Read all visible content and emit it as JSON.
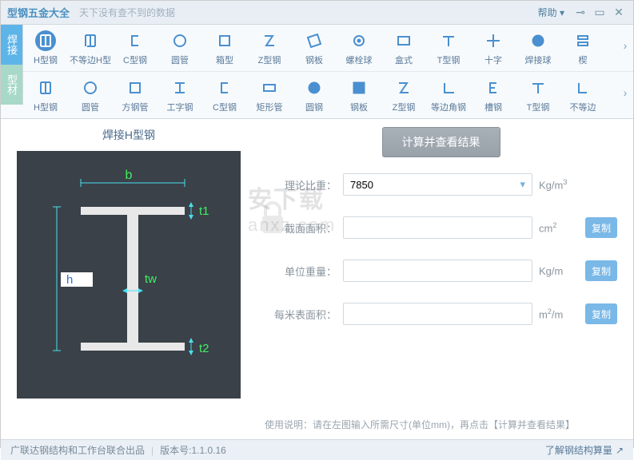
{
  "titlebar": {
    "title": "型钢五金大全",
    "subtitle": "天下没有查不到的数据",
    "help": "帮助"
  },
  "sideTabs": {
    "hj": "焊接",
    "xc": "型材"
  },
  "toolbar1": [
    {
      "label": "H型钢",
      "icon": "hbeam",
      "active": true
    },
    {
      "label": "不等边H型",
      "icon": "hbeam2"
    },
    {
      "label": "C型钢",
      "icon": "cshape"
    },
    {
      "label": "圆管",
      "icon": "circle"
    },
    {
      "label": "箱型",
      "icon": "box"
    },
    {
      "label": "Z型钢",
      "icon": "zshape"
    },
    {
      "label": "钢板",
      "icon": "plate"
    },
    {
      "label": "螺栓球",
      "icon": "bolt"
    },
    {
      "label": "盒式",
      "icon": "box2"
    },
    {
      "label": "T型钢",
      "icon": "tshape"
    },
    {
      "label": "十字",
      "icon": "cross"
    },
    {
      "label": "焊接球",
      "icon": "sphere"
    },
    {
      "label": "楔",
      "icon": "wedge"
    }
  ],
  "toolbar2": [
    {
      "label": "H型钢",
      "icon": "hbeam"
    },
    {
      "label": "圆管",
      "icon": "circle"
    },
    {
      "label": "方钢管",
      "icon": "box"
    },
    {
      "label": "工字钢",
      "icon": "ibeam"
    },
    {
      "label": "C型钢",
      "icon": "cshape"
    },
    {
      "label": "矩形管",
      "icon": "rect"
    },
    {
      "label": "圆钢",
      "icon": "disc"
    },
    {
      "label": "钢板",
      "icon": "plate2"
    },
    {
      "label": "Z型钢",
      "icon": "zshape"
    },
    {
      "label": "等边角钢",
      "icon": "angle"
    },
    {
      "label": "槽钢",
      "icon": "channel"
    },
    {
      "label": "T型钢",
      "icon": "tshape"
    },
    {
      "label": "不等边",
      "icon": "angle2"
    }
  ],
  "diagram": {
    "title": "焊接H型钢",
    "labels": {
      "b": "b",
      "h": "h",
      "t1": "t1",
      "t2": "t2",
      "tw": "tw"
    }
  },
  "form": {
    "calc": "计算并查看结果",
    "density_label": "理论比重：",
    "density_value": "7850",
    "density_unit": "Kg/m³",
    "area_label": "截面面积：",
    "area_unit": "cm²",
    "uweight_label": "单位重量：",
    "uweight_unit": "Kg/m",
    "surf_label": "每米表面积：",
    "surf_unit": "m²/m",
    "copy": "复制",
    "hint": "使用说明：请在左图输入所需尺寸(单位mm)，再点击【计算并查看结果】"
  },
  "footer": {
    "left": "广联达钢结构和工作台联合出品",
    "version_label": "版本号:",
    "version": "1.1.0.16",
    "right": "了解钢结构算量"
  },
  "watermark": "安下载",
  "watermark_url": "anxz.com"
}
